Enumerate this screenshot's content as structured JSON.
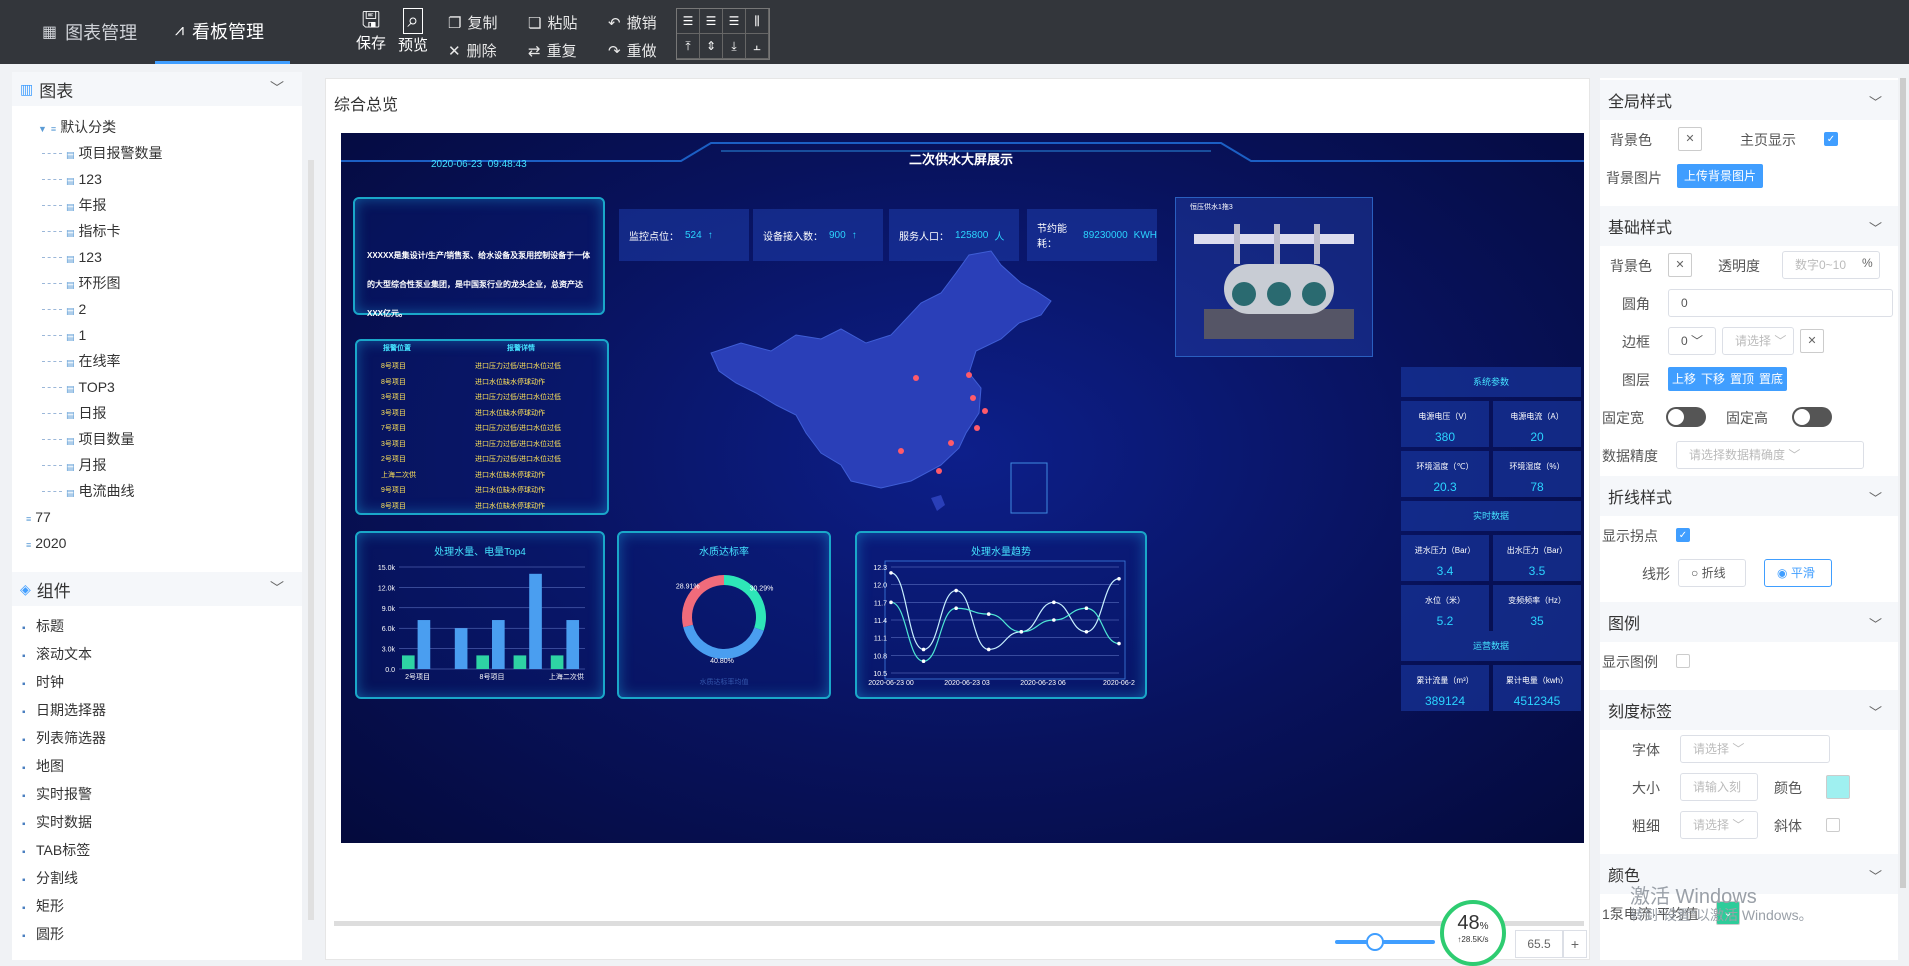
{
  "topbar": {
    "tab_chart": "图表管理",
    "tab_board": "看板管理",
    "save": "保存",
    "preview": "预览",
    "copy": "复制",
    "paste": "粘贴",
    "undo": "撤销",
    "delete": "删除",
    "repeat": "重复",
    "redo": "重做"
  },
  "left": {
    "charts_title": "图表",
    "tree_root": "默认分类",
    "tree_items": [
      "项目报警数量",
      "123",
      "年报",
      "指标卡",
      "123",
      "环形图",
      "2",
      "1",
      "在线率",
      "TOP3",
      "日报",
      "项目数量",
      "月报",
      "电流曲线"
    ],
    "tree_extra": [
      "77",
      "2020"
    ],
    "components_title": "组件",
    "components": [
      "标题",
      "滚动文本",
      "时钟",
      "日期选择器",
      "列表筛选器",
      "地图",
      "实时报警",
      "实时数据",
      "TAB标签",
      "分割线",
      "矩形",
      "圆形"
    ]
  },
  "board": {
    "title": "综合总览",
    "screen_title": "二次供水大屏展示",
    "datetime": "2020-06-23  09:48:43",
    "intro": "XXXXX是集设计/生产/销售泵、给水设备及泵用控制设备于一体的大型综合性泵业集团，是中国泵行业的龙头企业，总资产达XXX亿元。",
    "stats": [
      {
        "label": "监控点位：",
        "value": "524",
        "unit": "↑"
      },
      {
        "label": "设备接入数：",
        "value": "900",
        "unit": "↑"
      },
      {
        "label": "服务人口：",
        "value": "125800",
        "unit": "人"
      },
      {
        "label": "节约能耗：",
        "value": "89230000",
        "unit": "KWH"
      }
    ],
    "alarm_headers": [
      "报警位置",
      "报警详情"
    ],
    "alarms": [
      [
        "8号项目",
        "进口压力过低/进口水位过低"
      ],
      [
        "8号项目",
        "进口水位缺水停球动作"
      ],
      [
        "3号项目",
        "进口压力过低/进口水位过低"
      ],
      [
        "3号项目",
        "进口水位缺水停球动作"
      ],
      [
        "7号项目",
        "进口压力过低/进口水位过低"
      ],
      [
        "3号项目",
        "进口压力过低/进口水位过低"
      ],
      [
        "2号项目",
        "进口压力过低/进口水位过低"
      ],
      [
        "上海二次供",
        "进口水位缺水停球动作"
      ],
      [
        "9号项目",
        "进口水位缺水停球动作"
      ],
      [
        "8号项目",
        "进口水位缺水停球动作"
      ]
    ],
    "device_title": "恒压供水1拖3",
    "sys_title": "系统参数",
    "sys": [
      {
        "label": "电源电压（V）",
        "value": "380"
      },
      {
        "label": "电源电流（A）",
        "value": "20"
      },
      {
        "label": "环境温度（℃）",
        "value": "20.3"
      },
      {
        "label": "环境湿度（%）",
        "value": "78"
      }
    ],
    "rt_title": "实时数据",
    "rt": [
      {
        "label": "进水压力（Bar）",
        "value": "3.4"
      },
      {
        "label": "出水压力（Bar）",
        "value": "3.5"
      },
      {
        "label": "水位（米）",
        "value": "5.2"
      },
      {
        "label": "变频频率（Hz）",
        "value": "35"
      }
    ],
    "ops_title": "运营数据",
    "ops": [
      {
        "label": "累计流量（m³）",
        "value": "389124"
      },
      {
        "label": "累计电量（kwh）",
        "value": "4512345"
      }
    ],
    "bar_title": "处理水量、电量Top4",
    "donut_title": "水质达标率",
    "donut_caption": "水质达标率均值",
    "line_title": "处理水量趋势"
  },
  "chart_data": [
    {
      "type": "bar",
      "title": "处理水量、电量Top4",
      "categories": [
        "2号项目",
        "",
        "8号项目",
        "",
        "上海二次供"
      ],
      "series": [
        {
          "values": [
            7200,
            6000,
            7200,
            14000,
            7200
          ]
        },
        {
          "values": [
            2000,
            0,
            2000,
            2000,
            2000
          ]
        }
      ],
      "yticks": [
        "0.0",
        "3.0k",
        "6.0k",
        "9.0k",
        "12.0k",
        "15.0k"
      ],
      "ylim": [
        0,
        15000
      ],
      "colors": [
        "#4a9ef0",
        "#2ed3a4"
      ]
    },
    {
      "type": "pie",
      "title": "水质达标率",
      "labels": [
        "30.29%",
        "40.80%",
        "28.91%"
      ],
      "values": [
        30.29,
        40.8,
        28.91
      ],
      "colors": [
        "#2ee6b8",
        "#4a9ef0",
        "#f06b7b"
      ]
    },
    {
      "type": "line",
      "title": "处理水量趋势",
      "x": [
        "2020-06-23 00",
        "2020-06-23 03",
        "2020-06-23 06",
        "2020-06-2"
      ],
      "yticks": [
        "10.5",
        "10.8",
        "11.1",
        "11.4",
        "11.7",
        "12.0",
        "12.3"
      ],
      "ylim": [
        10.5,
        12.3
      ],
      "series": [
        {
          "values": [
            12.2,
            10.9,
            11.9,
            10.9,
            11.2,
            11.7,
            11.2,
            12.1
          ]
        },
        {
          "values": [
            11.7,
            10.7,
            11.6,
            11.5,
            11.2,
            11.4,
            11.6,
            11.0
          ]
        }
      ],
      "colors": [
        "#c8f0ff",
        "#4ee6d4"
      ]
    }
  ],
  "right": {
    "global_title": "全局样式",
    "bg_color": "背景色",
    "home_show": "主页显示",
    "bg_image": "背景图片",
    "upload_bg": "上传背景图片",
    "basic_title": "基础样式",
    "basic_bg": "背景色",
    "opacity": "透明度",
    "opacity_ph": "数字0~10",
    "opacity_unit": "%",
    "radius": "圆角",
    "radius_val": "0",
    "border": "边框",
    "border_val": "0",
    "border_sel_ph": "请选择",
    "layer": "图层",
    "layer_btns": [
      "上移",
      "下移",
      "置顶",
      "置底"
    ],
    "fix_w": "固定宽",
    "fix_h": "固定高",
    "precision": "数据精度",
    "precision_ph": "请选择数据精确度",
    "line_title": "折线样式",
    "show_points": "显示拐点",
    "line_shape": "线形",
    "shape_poly": "折线",
    "shape_smooth": "平滑",
    "legend_title": "图例",
    "show_legend": "显示图例",
    "tick_title": "刻度标签",
    "font": "字体",
    "font_ph": "请选择",
    "size": "大小",
    "size_ph": "请输入刻",
    "color": "颜色",
    "weight": "粗细",
    "weight_ph": "请选择",
    "italic": "斜体",
    "colors_title": "颜色",
    "series_name": "1泵电流·平均值"
  },
  "zoom": {
    "value": "65.5",
    "plus": "+"
  },
  "netmeter": {
    "percent": "48",
    "rate": "↑28.5K/s"
  },
  "watermark": {
    "line1": "激活 Windows",
    "line2": "转到\"设置\"以激活 Windows。"
  },
  "accent": "#409eff"
}
